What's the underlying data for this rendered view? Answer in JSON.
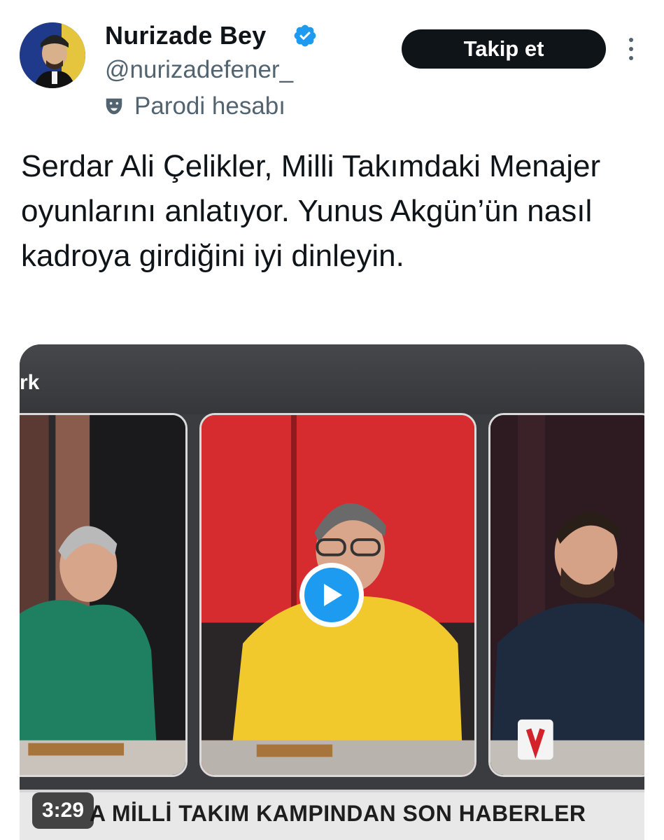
{
  "author": {
    "display_name": "Nurizade Bey",
    "handle": "@nurizadefener_",
    "parody_label": "Parodi hesabı",
    "verified": true,
    "verified_color": "#1d9bf0"
  },
  "actions": {
    "follow_label": "Takip et"
  },
  "tweet": {
    "text": "Serdar Ali Çelikler, Milli Takımdaki Menajer oyunlarını anlatıyor. Yunus Akgün’ün nasıl kadroya girdiğini iyi dinleyin."
  },
  "media": {
    "type": "video",
    "channel_logo_fragment": "rk",
    "ticker_text": "A MİLLİ TAKIM KAMPINDAN SON HABERLER",
    "duration": "3:29",
    "icons": [
      "play-icon"
    ]
  },
  "colors": {
    "accent": "#1d9bf0",
    "follow_button_bg": "#0f1419",
    "secondary_text": "#536471"
  }
}
